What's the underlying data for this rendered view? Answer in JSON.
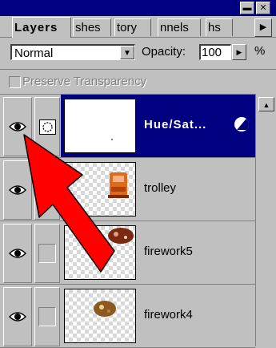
{
  "titlebar": {
    "minimize_glyph": "▬",
    "close_glyph": "✕"
  },
  "tabs": [
    {
      "label": "Layers",
      "active": true
    },
    {
      "label": "shes",
      "active": false
    },
    {
      "label": "tory",
      "active": false
    },
    {
      "label": "nnels",
      "active": false
    },
    {
      "label": "hs",
      "active": false
    }
  ],
  "tab_scroll_glyph": "▶",
  "blend_mode": {
    "value": "Normal",
    "dropdown_glyph": "▼"
  },
  "opacity": {
    "label": "Opacity:",
    "value": "100",
    "arrow_glyph": "▶",
    "unit": "%"
  },
  "preserve_transparency": {
    "label": "Preserve Transparency",
    "checked": false,
    "enabled": false
  },
  "layers": [
    {
      "name": "Hue/Sat...",
      "selected": true,
      "visible": true,
      "type": "adjustment"
    },
    {
      "name": "trolley",
      "selected": false,
      "visible": true,
      "type": "pixel"
    },
    {
      "name": "firework5",
      "selected": false,
      "visible": true,
      "type": "pixel"
    },
    {
      "name": "firework4",
      "selected": false,
      "visible": true,
      "type": "pixel"
    }
  ],
  "scrollbar": {
    "up_glyph": "▲"
  },
  "colors": {
    "selection": "#000080",
    "panel": "#c0c0c0",
    "annotation_arrow": "#ff0000"
  },
  "icons": {
    "visibility": "eye-icon",
    "adjustment": "adjustment-layer-icon",
    "mask": "layer-mask-icon"
  }
}
